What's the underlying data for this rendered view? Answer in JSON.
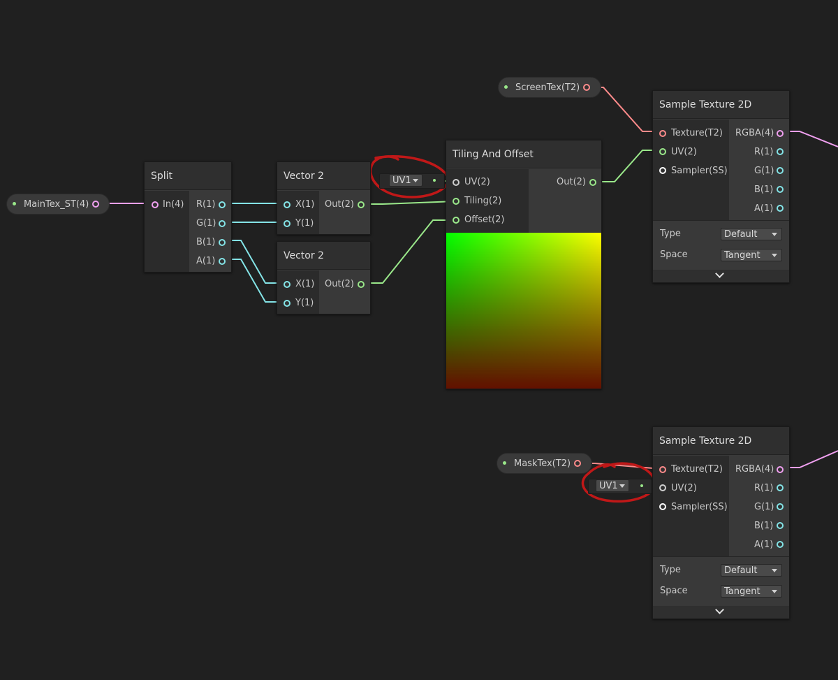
{
  "properties": {
    "maintex": "MainTex_ST(4)",
    "screentex": "ScreenTex(T2)",
    "masktex": "MaskTex(T2)"
  },
  "split": {
    "title": "Split",
    "input": "In(4)",
    "outputs": [
      "R(1)",
      "G(1)",
      "B(1)",
      "A(1)"
    ]
  },
  "vector2_a": {
    "title": "Vector 2",
    "inputs": [
      "X(1)",
      "Y(1)"
    ],
    "output": "Out(2)"
  },
  "vector2_b": {
    "title": "Vector 2",
    "inputs": [
      "X(1)",
      "Y(1)"
    ],
    "output": "Out(2)"
  },
  "tiling": {
    "title": "Tiling And Offset",
    "uv_default": "UV1",
    "inputs": [
      "UV(2)",
      "Tiling(2)",
      "Offset(2)"
    ],
    "output": "Out(2)"
  },
  "sample_top": {
    "title": "Sample Texture 2D",
    "inputs": [
      "Texture(T2)",
      "UV(2)",
      "Sampler(SS)"
    ],
    "outputs": [
      "RGBA(4)",
      "R(1)",
      "G(1)",
      "B(1)",
      "A(1)"
    ],
    "type_label": "Type",
    "type_value": "Default",
    "space_label": "Space",
    "space_value": "Tangent"
  },
  "sample_bottom": {
    "title": "Sample Texture 2D",
    "uv_default": "UV1",
    "inputs": [
      "Texture(T2)",
      "UV(2)",
      "Sampler(SS)"
    ],
    "outputs": [
      "RGBA(4)",
      "R(1)",
      "G(1)",
      "B(1)",
      "A(1)"
    ],
    "type_label": "Type",
    "type_value": "Default",
    "space_label": "Space",
    "space_value": "Tangent"
  },
  "colors": {
    "vec4": "#f0a0f0",
    "vec1": "#84e4e7",
    "vec2": "#9ae88a",
    "texture": "#ff8b8b",
    "sampler": "#ffffff",
    "annotation": "#c01818"
  }
}
